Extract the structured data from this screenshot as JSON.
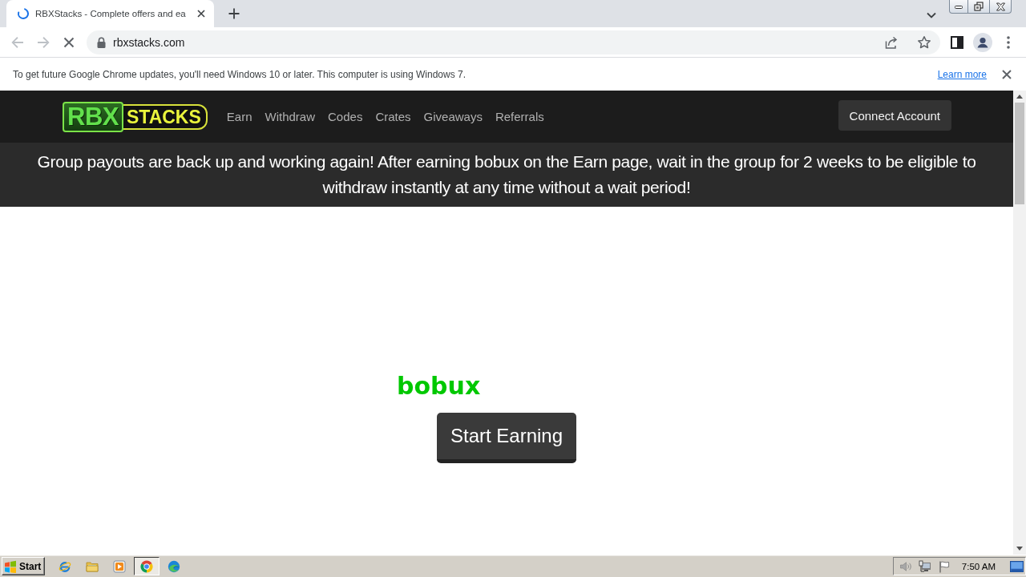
{
  "browser": {
    "tabs": [
      {
        "title": "RBXStacks - Complete offers and ea",
        "selected": true,
        "loading": true
      }
    ],
    "toolbar": {
      "back_disabled": true,
      "forward_disabled": true,
      "address": "rbxstacks.com"
    },
    "infobar": {
      "message": "To get future Google Chrome updates, you'll need Windows 10 or later. This computer is using Windows 7.",
      "link": "Learn more"
    }
  },
  "site": {
    "logo": {
      "prefix": "RBX",
      "suffix": "STACKS"
    },
    "nav": [
      "Earn",
      "Withdraw",
      "Codes",
      "Crates",
      "Giveaways",
      "Referrals"
    ],
    "connect_button": "Connect Account",
    "announcement": "Group payouts are back up and working again! After earning bobux on the Earn page, wait in the group for 2 weeks to be eligible to withdraw instantly at any time without a wait period!",
    "headline": "bobux",
    "start_button": "Start Earning"
  },
  "taskbar": {
    "start": "Start",
    "apps": [
      {
        "kind": "ie",
        "selected": false
      },
      {
        "kind": "folder",
        "selected": false
      },
      {
        "kind": "player",
        "selected": false
      },
      {
        "kind": "chrome",
        "selected": true
      },
      {
        "kind": "edge",
        "selected": false
      }
    ],
    "clock": "7:50 AM"
  }
}
